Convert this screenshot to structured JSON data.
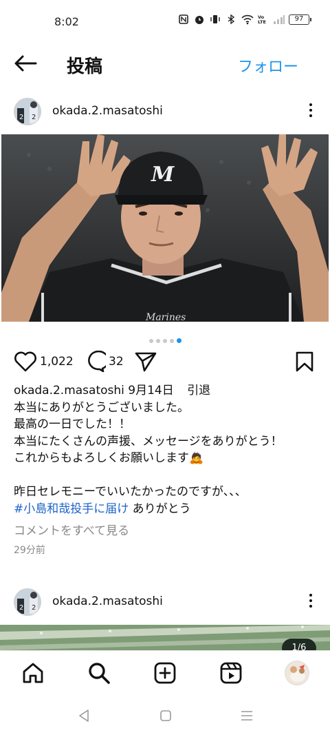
{
  "status": {
    "time": "8:02",
    "battery": "97",
    "icons": [
      "nfc-icon",
      "alarm-icon",
      "vibrate-icon",
      "bluetooth-icon",
      "wifi-icon",
      "volte-icon",
      "signal-icon",
      "battery-icon"
    ]
  },
  "header": {
    "title": "投稿",
    "follow_label": "フォロー"
  },
  "post": {
    "username": "okada.2.masatoshi",
    "likes": "1,022",
    "comments": "32",
    "carousel_total": 5,
    "carousel_active": 5,
    "caption": {
      "user": "okada.2.masatoshi",
      "date": "9月14日",
      "tag": "引退",
      "line1": "本当にありがとうございました。",
      "line2": "最高の一日でした！！",
      "line3": "本当にたくさんの声援、メッセージをありがとう！",
      "line4": "これからもよろしくお願いします🙇",
      "line5": "昨日セレモニーでいいたかったのですが、、、",
      "hashtag": "#小島和哉投手に届け",
      "hashtag_suffix": " ありがとう"
    },
    "view_comments": "コメントをすべて見る",
    "time_ago": "29分前"
  },
  "post2": {
    "username": "okada.2.masatoshi",
    "counter": "1/6"
  },
  "colors": {
    "accent": "#1d93ea",
    "hashtag": "#1e64c8"
  }
}
